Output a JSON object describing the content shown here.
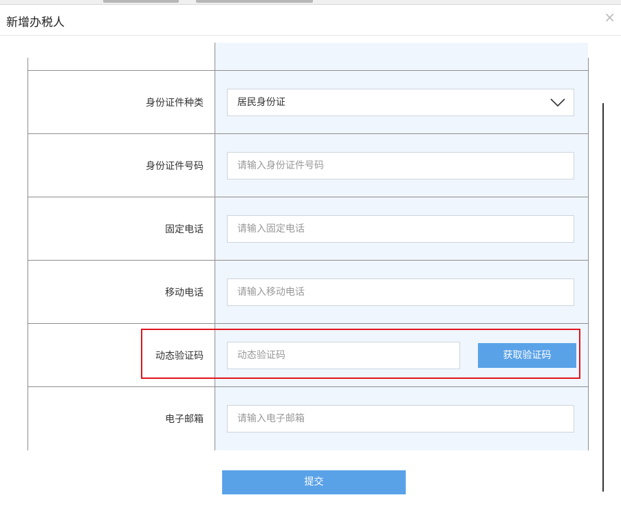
{
  "modal": {
    "title": "新增办税人",
    "close_glyph": "×"
  },
  "form": {
    "id_type": {
      "label": "身份证件种类",
      "value": "居民身份证"
    },
    "id_number": {
      "label": "身份证件号码",
      "placeholder": "请输入身份证件号码"
    },
    "landline": {
      "label": "固定电话",
      "placeholder": "请输入固定电话"
    },
    "mobile": {
      "label": "移动电话",
      "placeholder": "请输入移动电话"
    },
    "verify_code": {
      "label": "动态验证码",
      "placeholder": "动态验证码",
      "button_label": "获取验证码"
    },
    "email": {
      "label": "电子邮箱",
      "placeholder": "请输入电子邮箱"
    }
  },
  "submit_label": "提交",
  "colors": {
    "primary_button": "#5aa2e8",
    "highlight_border": "#e0141e",
    "value_cell_bg": "#f0f6fd"
  }
}
